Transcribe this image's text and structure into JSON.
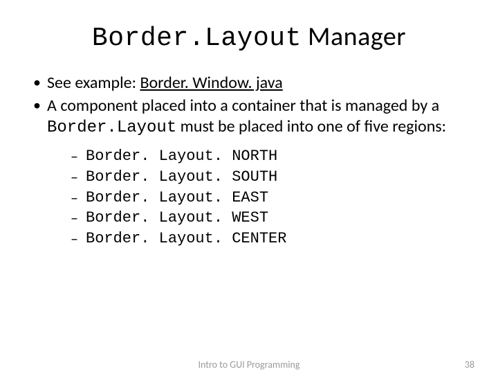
{
  "title": {
    "code": "Border.Layout",
    "rest": " Manager"
  },
  "bullets": {
    "b1_prefix": "See example: ",
    "b1_link": "Border. Window. java",
    "b2_pre": "A component placed into a container that is managed by a ",
    "b2_code": "Border.Layout",
    "b2_post": " must be placed into one of five regions:"
  },
  "regions": [
    "Border. Layout. NORTH",
    "Border. Layout. SOUTH",
    "Border. Layout. EAST",
    "Border. Layout. WEST",
    "Border. Layout. CENTER"
  ],
  "footer": {
    "center": "Intro to GUI Programming",
    "page": "38"
  }
}
